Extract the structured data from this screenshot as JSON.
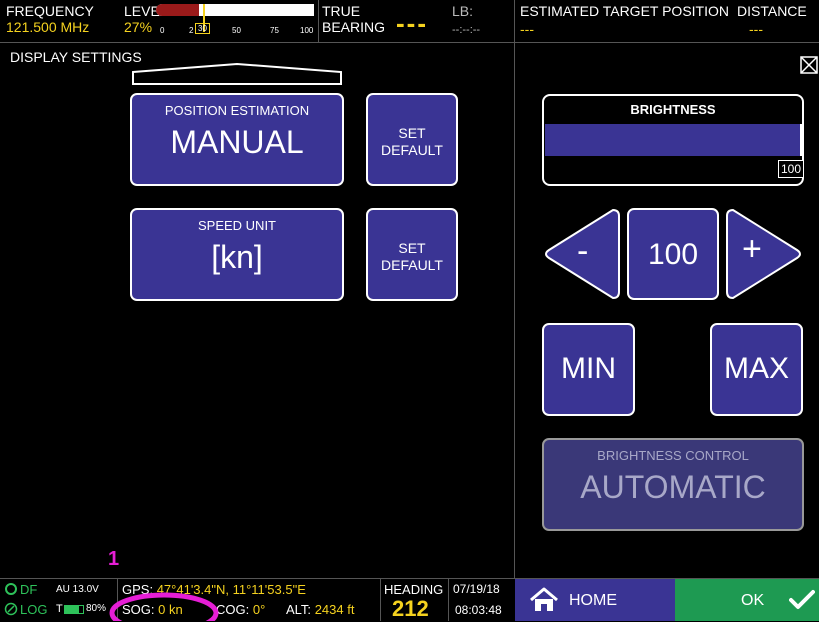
{
  "top": {
    "frequency_label": "FREQUENCY",
    "frequency_value": "121.500 MHz",
    "level_label": "LEVEL",
    "level_value": "27%",
    "scale_ticks": [
      "0",
      "2",
      "30",
      "50",
      "75",
      "100"
    ],
    "true_label": "TRUE",
    "bearing_label": "BEARING",
    "bearing_value": "---",
    "lb_label": "LB:",
    "lb_value": "--:--:--",
    "target_label": "ESTIMATED TARGET POSITION",
    "target_value": "---",
    "distance_label": "DISTANCE",
    "distance_value": "---"
  },
  "page_title": "DISPLAY SETTINGS",
  "left": {
    "position_estimation": {
      "label": "POSITION ESTIMATION",
      "value": "MANUAL"
    },
    "speed_unit": {
      "label": "SPEED UNIT",
      "value": "[kn]"
    },
    "set_default_1": "SET DEFAULT",
    "set_default_2": "SET DEFAULT"
  },
  "right": {
    "brightness_label": "BRIGHTNESS",
    "brightness_readout": "100",
    "brightness_level_pct": 100,
    "minus_label": "-",
    "value_label": "100",
    "plus_label": "+",
    "min_label": "MIN",
    "max_label": "MAX",
    "control_label": "BRIGHTNESS CONTROL",
    "control_value": "AUTOMATIC"
  },
  "annotation": "1",
  "bottom": {
    "df_label": "DF",
    "au_label": "AU 13.0V",
    "log_label": "LOG",
    "t_label": "T",
    "battery_value": "80%",
    "gps_label": "GPS:",
    "gps_value": "47°41'3.4\"N, 11°11'53.5\"E",
    "sog_label": "SOG:",
    "sog_value": "0 kn",
    "cog_label": "COG:",
    "cog_value": "0°",
    "alt_label": "ALT:",
    "alt_value": "2434 ft",
    "heading_label": "HEADING",
    "heading_value": "212",
    "date": "07/19/18",
    "time": "08:03:48",
    "home_label": "HOME",
    "ok_label": "OK"
  },
  "colors": {
    "accent_blue": "#3a3494",
    "yellow": "#f5d21f",
    "green": "#1e9a52",
    "annotation_magenta": "#e61ed6",
    "level_red": "#9a1a1a"
  }
}
